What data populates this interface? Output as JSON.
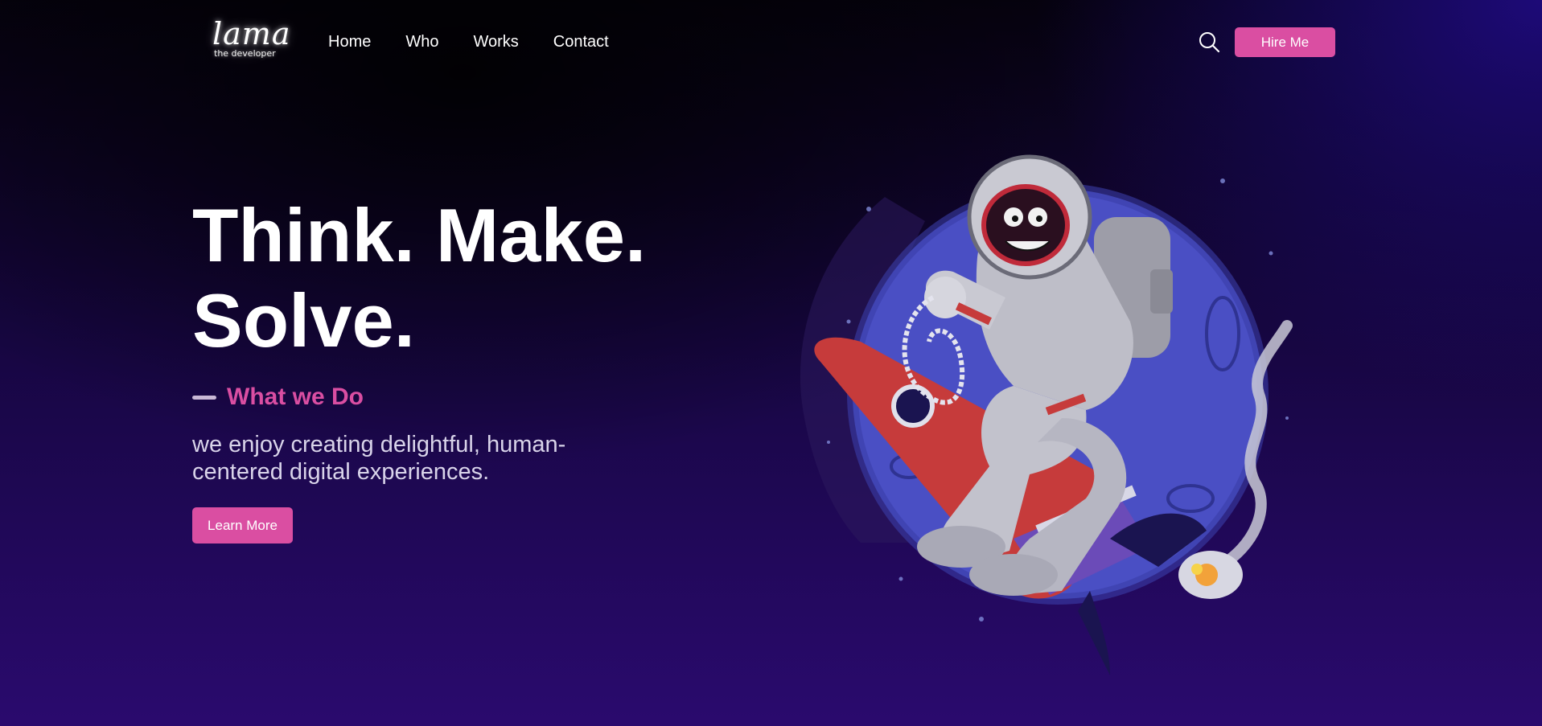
{
  "nav": {
    "logo": {
      "main": "lama",
      "sub": "the developer"
    },
    "links": [
      "Home",
      "Who",
      "Works",
      "Contact"
    ],
    "hire_label": "Hire Me",
    "search_icon": "search-icon"
  },
  "hero": {
    "headline_line1": "Think. Make.",
    "headline_line2": "Solve.",
    "subheading": "What we Do",
    "description": "we enjoy creating delightful, human-centered digital experiences.",
    "cta_label": "Learn More",
    "illustration": "astronaut-riding-rocket"
  },
  "colors": {
    "accent": "#da4ea2",
    "background_dark": "#06020f",
    "background_purple": "#2a0a6e",
    "planet_blue": "#4a4fc4"
  }
}
